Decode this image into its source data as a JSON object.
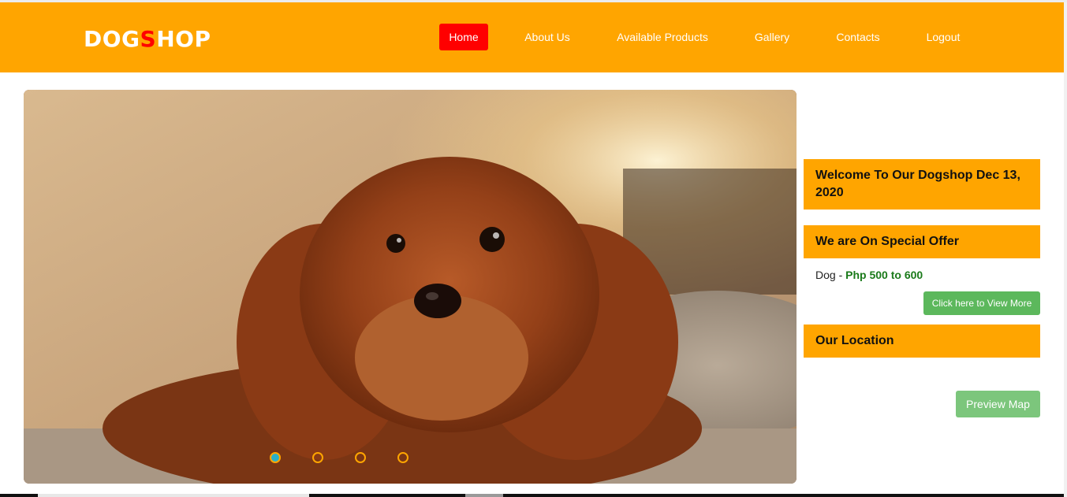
{
  "brand": {
    "part1": "DOG",
    "accent": "S",
    "part2": "HOP"
  },
  "nav": {
    "items": [
      {
        "label": "Home",
        "active": true
      },
      {
        "label": "About Us"
      },
      {
        "label": "Available Products"
      },
      {
        "label": "Gallery"
      },
      {
        "label": "Contacts"
      },
      {
        "label": "Logout"
      }
    ]
  },
  "carousel": {
    "slide_count": 4,
    "active_index": 0
  },
  "sidebar": {
    "welcome": "Welcome To Our Dogshop Dec 13, 2020",
    "special_heading": "We are On Special Offer",
    "offer_item": "Dog",
    "offer_separator": " - ",
    "offer_price": "Php 500 to 600",
    "view_more_label": "Click here to View More",
    "location_heading": "Our Location",
    "preview_map_label": "Preview Map"
  },
  "colors": {
    "header": "#ffa500",
    "active_nav": "#ff0000",
    "button_green": "#5cb85c",
    "price_green": "#1a7a1a",
    "dot_active": "#2ab0c8"
  }
}
